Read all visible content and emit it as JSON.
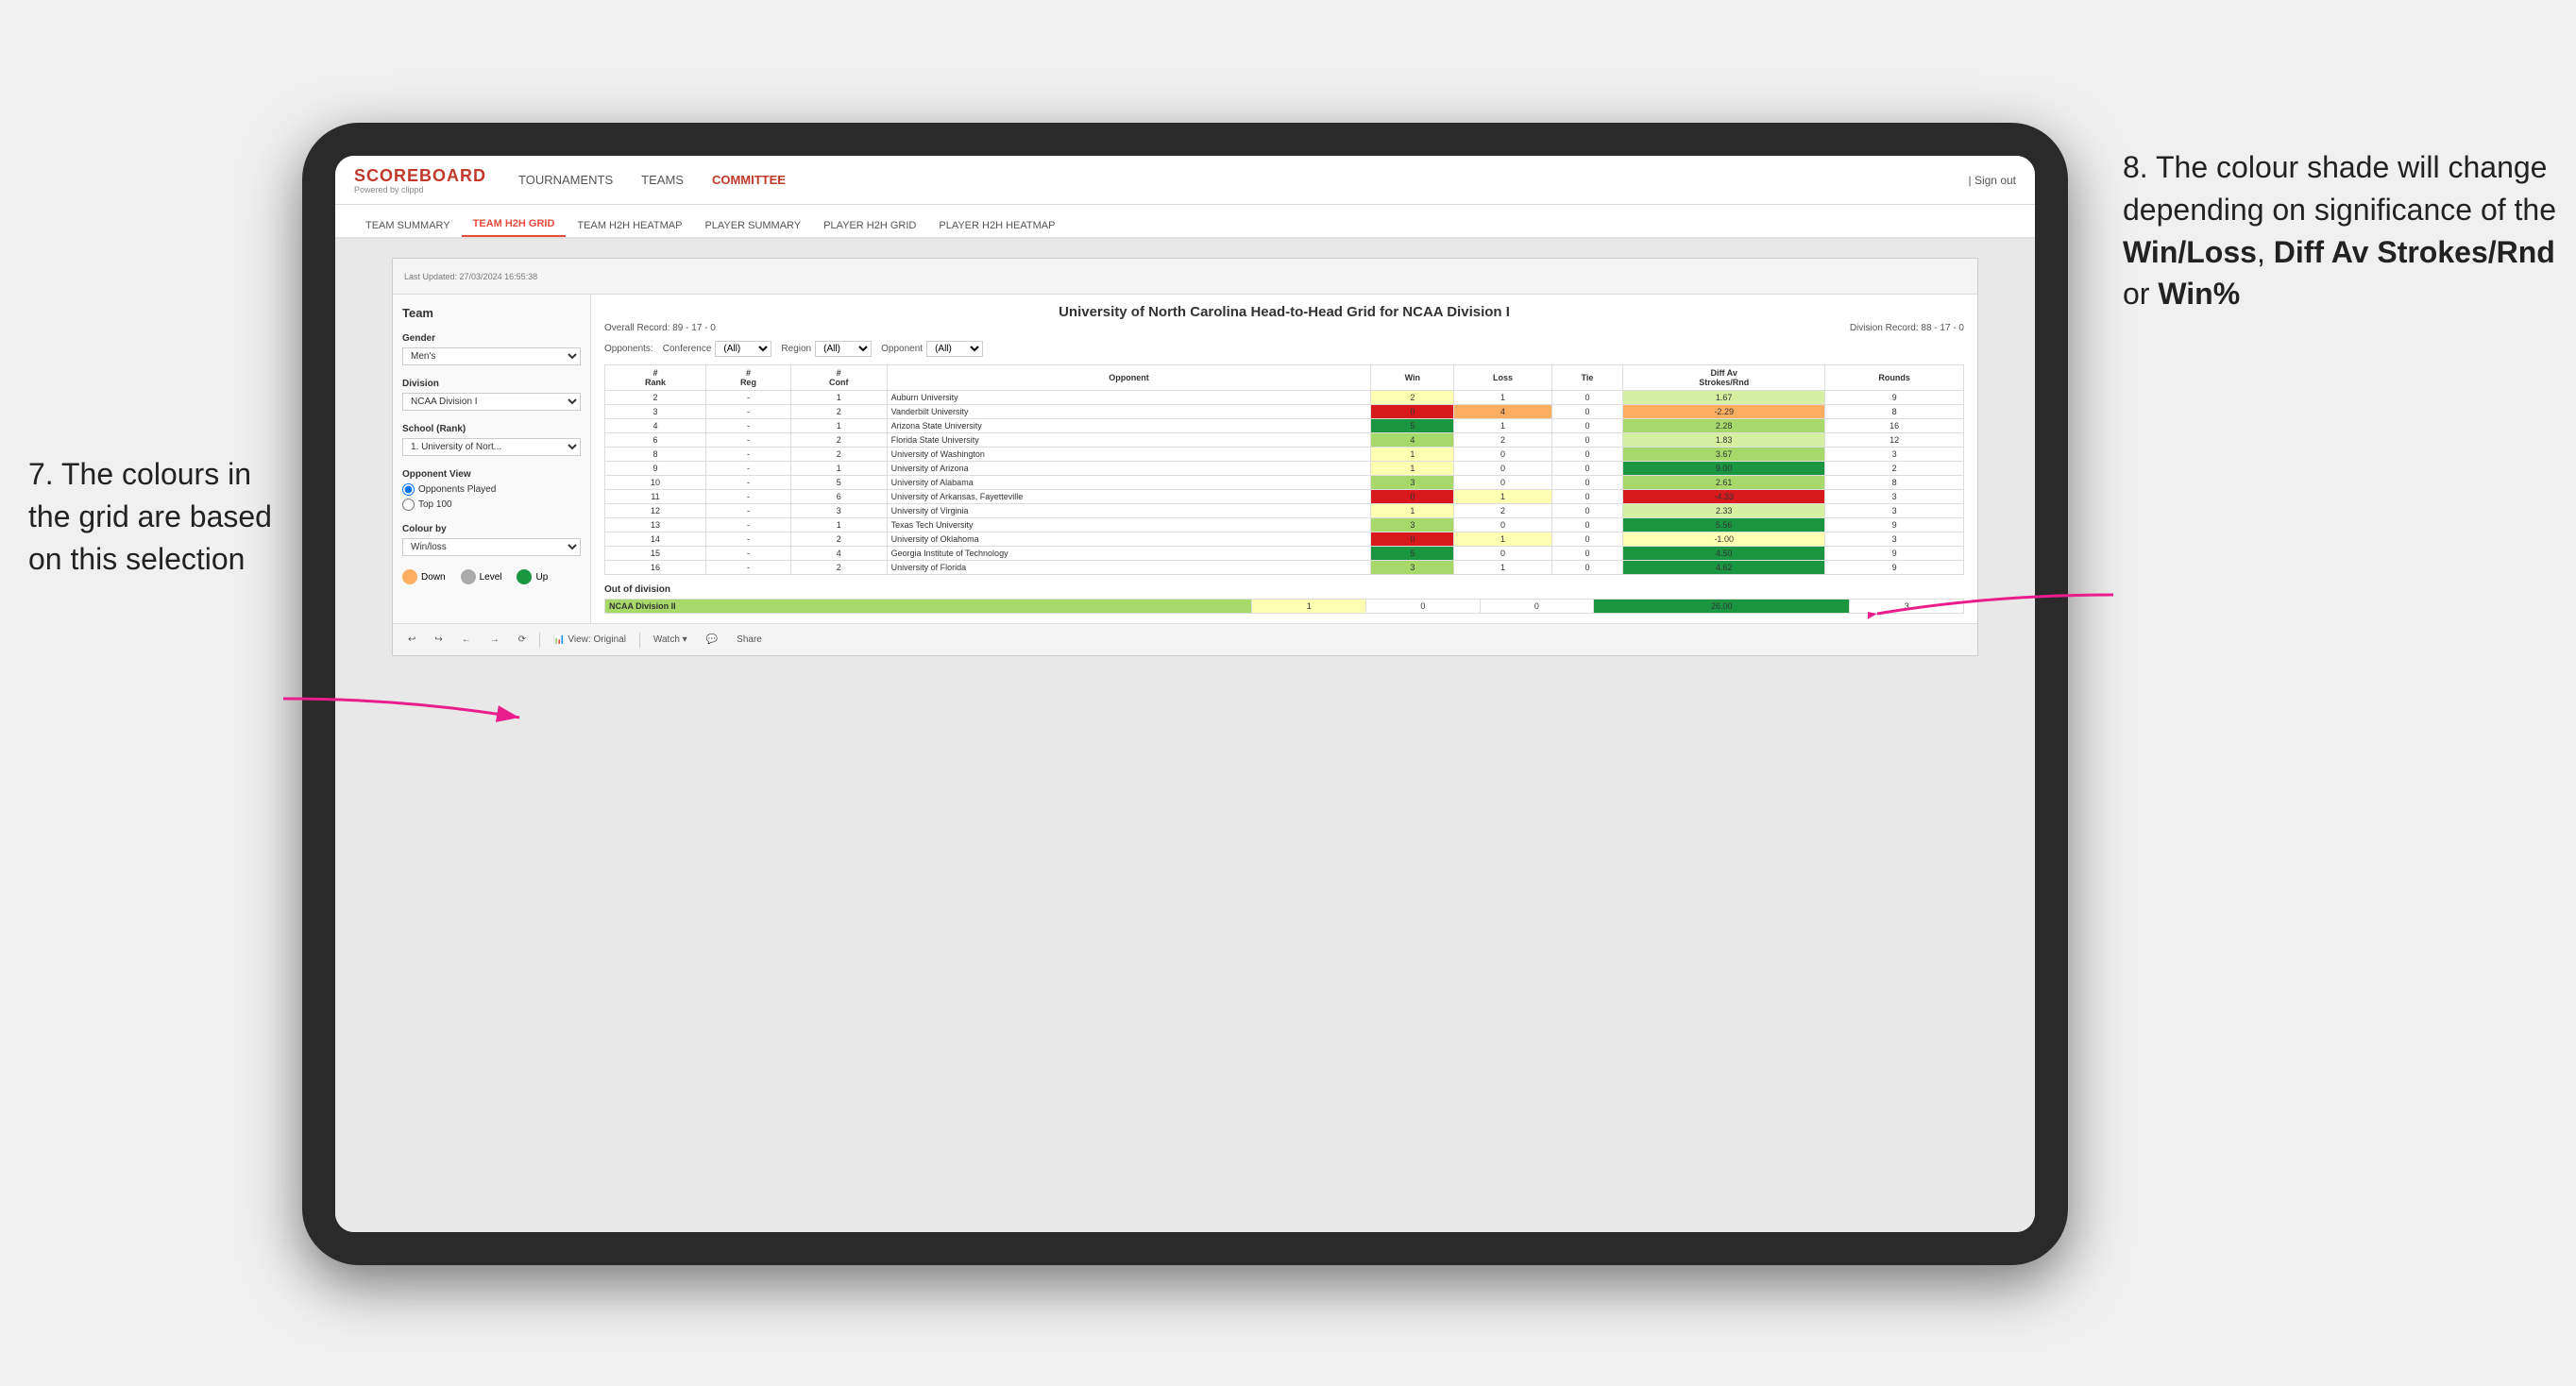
{
  "annotations": {
    "left_title": "7. The colours in the grid are based on this selection",
    "right_title": "8. The colour shade will change depending on significance of the",
    "right_bold1": "Win/Loss",
    "right_sep1": ", ",
    "right_bold2": "Diff Av Strokes/Rnd",
    "right_sep2": " or ",
    "right_bold3": "Win%"
  },
  "nav": {
    "logo": "SCOREBOARD",
    "logo_sub": "Powered by clippd",
    "links": [
      "TOURNAMENTS",
      "TEAMS",
      "COMMITTEE"
    ],
    "sign_out": "| Sign out"
  },
  "sub_nav": {
    "items": [
      "TEAM SUMMARY",
      "TEAM H2H GRID",
      "TEAM H2H HEATMAP",
      "PLAYER SUMMARY",
      "PLAYER H2H GRID",
      "PLAYER H2H HEATMAP"
    ],
    "active": "TEAM H2H GRID"
  },
  "tableau": {
    "last_updated": "Last Updated: 27/03/2024 16:55:38",
    "title": "University of North Carolina Head-to-Head Grid for NCAA Division I",
    "overall_record": "Overall Record: 89 - 17 - 0",
    "division_record": "Division Record: 88 - 17 - 0",
    "sidebar": {
      "team_label": "Team",
      "gender_label": "Gender",
      "gender_value": "Men's",
      "division_label": "Division",
      "division_value": "NCAA Division I",
      "school_label": "School (Rank)",
      "school_value": "1. University of Nort...",
      "opponent_view_label": "Opponent View",
      "opponent_options": [
        "Opponents Played",
        "Top 100"
      ],
      "opponent_selected": "Opponents Played",
      "colour_by_label": "Colour by",
      "colour_by_options": [
        "Win/loss",
        "Diff Av Strokes/Rnd",
        "Win%"
      ],
      "colour_by_selected": "Win/loss"
    },
    "filters": {
      "opponents_label": "Opponents:",
      "conference_label": "Conference",
      "conference_value": "(All)",
      "region_label": "Region",
      "region_value": "(All)",
      "opponent_label": "Opponent",
      "opponent_value": "(All)"
    },
    "table_headers": [
      "# Rank",
      "# Reg",
      "# Conf",
      "Opponent",
      "Win",
      "Loss",
      "Tie",
      "Diff Av Strokes/Rnd",
      "Rounds"
    ],
    "rows": [
      {
        "rank": "2",
        "reg": "-",
        "conf": "1",
        "opponent": "Auburn University",
        "win": 2,
        "loss": 1,
        "tie": 0,
        "diff": "1.67",
        "rounds": 9,
        "win_color": "yellow",
        "loss_color": "white",
        "diff_color": "green_light"
      },
      {
        "rank": "3",
        "reg": "-",
        "conf": "2",
        "opponent": "Vanderbilt University",
        "win": 0,
        "loss": 4,
        "tie": 0,
        "diff": "-2.29",
        "rounds": 8,
        "win_color": "red",
        "loss_color": "orange",
        "diff_color": "orange"
      },
      {
        "rank": "4",
        "reg": "-",
        "conf": "1",
        "opponent": "Arizona State University",
        "win": 5,
        "loss": 1,
        "tie": 0,
        "diff": "2.28",
        "rounds": 16,
        "win_color": "green_dark",
        "loss_color": "white",
        "diff_color": "green_mid"
      },
      {
        "rank": "6",
        "reg": "-",
        "conf": "2",
        "opponent": "Florida State University",
        "win": 4,
        "loss": 2,
        "tie": 0,
        "diff": "1.83",
        "rounds": 12,
        "win_color": "green_mid",
        "loss_color": "white",
        "diff_color": "green_light"
      },
      {
        "rank": "8",
        "reg": "-",
        "conf": "2",
        "opponent": "University of Washington",
        "win": 1,
        "loss": 0,
        "tie": 0,
        "diff": "3.67",
        "rounds": 3,
        "win_color": "yellow",
        "loss_color": "white",
        "diff_color": "green_mid"
      },
      {
        "rank": "9",
        "reg": "-",
        "conf": "1",
        "opponent": "University of Arizona",
        "win": 1,
        "loss": 0,
        "tie": 0,
        "diff": "9.00",
        "rounds": 2,
        "win_color": "yellow",
        "loss_color": "white",
        "diff_color": "green_dark"
      },
      {
        "rank": "10",
        "reg": "-",
        "conf": "5",
        "opponent": "University of Alabama",
        "win": 3,
        "loss": 0,
        "tie": 0,
        "diff": "2.61",
        "rounds": 8,
        "win_color": "green_mid",
        "loss_color": "white",
        "diff_color": "green_mid"
      },
      {
        "rank": "11",
        "reg": "-",
        "conf": "6",
        "opponent": "University of Arkansas, Fayetteville",
        "win": 0,
        "loss": 1,
        "tie": 0,
        "diff": "-4.33",
        "rounds": 3,
        "win_color": "red",
        "loss_color": "yellow",
        "diff_color": "red"
      },
      {
        "rank": "12",
        "reg": "-",
        "conf": "3",
        "opponent": "University of Virginia",
        "win": 1,
        "loss": 2,
        "tie": 0,
        "diff": "2.33",
        "rounds": 3,
        "win_color": "yellow",
        "loss_color": "white",
        "diff_color": "green_light"
      },
      {
        "rank": "13",
        "reg": "-",
        "conf": "1",
        "opponent": "Texas Tech University",
        "win": 3,
        "loss": 0,
        "tie": 0,
        "diff": "5.56",
        "rounds": 9,
        "win_color": "green_mid",
        "loss_color": "white",
        "diff_color": "green_dark"
      },
      {
        "rank": "14",
        "reg": "-",
        "conf": "2",
        "opponent": "University of Oklahoma",
        "win": 0,
        "loss": 1,
        "tie": 0,
        "diff": "-1.00",
        "rounds": 3,
        "win_color": "red",
        "loss_color": "yellow",
        "diff_color": "yellow"
      },
      {
        "rank": "15",
        "reg": "-",
        "conf": "4",
        "opponent": "Georgia Institute of Technology",
        "win": 5,
        "loss": 0,
        "tie": 0,
        "diff": "4.50",
        "rounds": 9,
        "win_color": "green_dark",
        "loss_color": "white",
        "diff_color": "green_dark"
      },
      {
        "rank": "16",
        "reg": "-",
        "conf": "2",
        "opponent": "University of Florida",
        "win": 3,
        "loss": 1,
        "tie": 0,
        "diff": "4.62",
        "rounds": 9,
        "win_color": "green_mid",
        "loss_color": "white",
        "diff_color": "green_dark"
      }
    ],
    "out_of_division_label": "Out of division",
    "out_of_division_rows": [
      {
        "division": "NCAA Division II",
        "win": 1,
        "loss": 0,
        "tie": 0,
        "diff": "26.00",
        "rounds": 3,
        "win_color": "yellow",
        "diff_color": "green_dark"
      }
    ],
    "legend": {
      "down_label": "Down",
      "level_label": "Level",
      "up_label": "Up"
    },
    "toolbar": {
      "view_label": "View: Original",
      "watch_label": "Watch ▾",
      "share_label": "Share"
    }
  }
}
